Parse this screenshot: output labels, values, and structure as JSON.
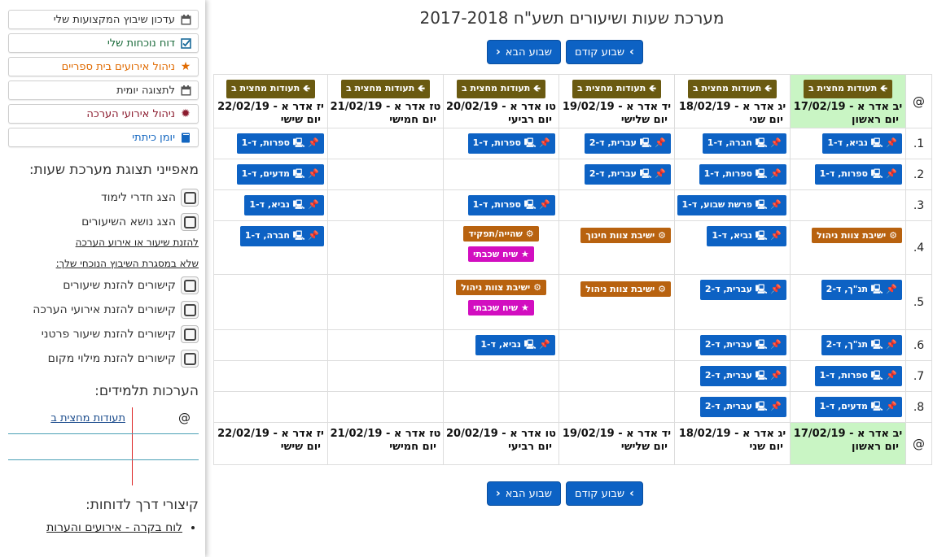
{
  "sidebar": {
    "buttons": [
      {
        "label": "עדכון שיבוץ המקצועות שלי",
        "icon": "calendar-icon"
      },
      {
        "label": "דוח נוכחות שלי",
        "icon": "checkbox-icon"
      },
      {
        "label": "ניהול אירועים בית ספריים",
        "icon": "star-icon"
      },
      {
        "label": "לתצוגה יומית",
        "icon": "calendar-icon"
      },
      {
        "label": "ניהול אירועי הערכה",
        "icon": "burst-icon"
      },
      {
        "label": "יומן כיתתי",
        "icon": "book-icon"
      }
    ],
    "features_heading": "מאפייני תצוגת מערכת שעות:",
    "options": [
      "הצג חדרי לימוד",
      "הצג נושא השיעורים"
    ],
    "note_link_1": "להזנת שיעור או אירוע הערכה",
    "note_link_2": "שלא במסגרת השיבוץ הנוכחי שלך:",
    "link_options": [
      "קישורים להזנת שיעורים",
      "קישורים להזנת אירועי הערכה",
      "קישורים להזנת שיעור פרטני",
      "קישורים להזנת מילוי מקום"
    ],
    "evaluations_heading": "הערכות תלמידים:",
    "eval_at": "@",
    "eval_link": "תעודות מחצית ב",
    "reports_heading": "קיצורי דרך לדוחות:",
    "report_links": [
      "לוח בקרה - אירועים והערות"
    ]
  },
  "main": {
    "title": "מערכת שעות ושיעורים תשע\"ח 2017-2018",
    "prev_week": "שבוע קודם",
    "next_week": "שבוע הבא",
    "corner": "@",
    "grade_pill": "תעודות מחצית ב",
    "days": [
      {
        "date": "יב אדר א - 17/02/19",
        "name": "יום ראשון",
        "today": true
      },
      {
        "date": "יג אדר א - 18/02/19",
        "name": "יום שני",
        "today": false
      },
      {
        "date": "יד אדר א - 19/02/19",
        "name": "יום שלישי",
        "today": false
      },
      {
        "date": "טו אדר א - 20/02/19",
        "name": "יום רביעי",
        "today": false
      },
      {
        "date": "טז אדר א - 21/02/19",
        "name": "יום חמישי",
        "today": false
      },
      {
        "date": "יז אדר א - 22/02/19",
        "name": "יום שישי",
        "today": false
      }
    ],
    "periods": [
      "1.",
      "2.",
      "3.",
      "4.",
      "5.",
      "6.",
      "7.",
      "8."
    ],
    "lessons": {
      "p1": [
        "נביא, ד-1",
        "חברה, ד-1",
        "עברית, ד-2",
        "ספרות, ד-1",
        "",
        "ספרות, ד-1"
      ],
      "p2": [
        "ספרות, ד-1",
        "ספרות, ד-1",
        "עברית, ד-2",
        "",
        "",
        "מדעים, ד-1"
      ],
      "p3": [
        "",
        "פרשת שבוע, ד-1",
        "",
        "ספרות, ד-1",
        "",
        "נביא, ד-1"
      ],
      "p4_day1": "ישיבת צוות ניהול",
      "p4_day2": "נביא, ד-1",
      "p4_day3": "ישיבת צוות חינוך",
      "p4_day4a": "שהייה/תפקיד",
      "p4_day4b": "שיח שכבתי",
      "p4_day6": "חברה, ד-1",
      "p5_day1": "תנ\"ך, ד-2",
      "p5_day2": "עברית, ד-2",
      "p5_day3": "ישיבת צוות ניהול",
      "p5_day4a": "ישיבת צוות ניהול",
      "p5_day4b": "שיח שכבתי",
      "p6": [
        "תנ\"ך, ד-2",
        "עברית, ד-2",
        "",
        "נביא, ד-1",
        "",
        ""
      ],
      "p7": [
        "ספרות, ד-1",
        "עברית, ד-2",
        "",
        "",
        "",
        ""
      ],
      "p8": [
        "מדעים, ד-1",
        "עברית, ד-2",
        "",
        "",
        "",
        ""
      ]
    }
  },
  "colors": {
    "lesson_blue": "#0d62c4",
    "meeting_brown": "#b8620f",
    "event_magenta": "#d20ec0",
    "grade_pill": "#6a5a11",
    "today_green": "#c9f5c4"
  }
}
